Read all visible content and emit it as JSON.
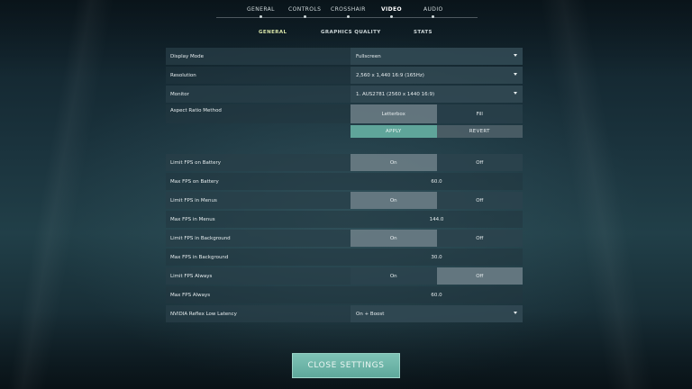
{
  "top_tabs": [
    {
      "label": "GENERAL"
    },
    {
      "label": "CONTROLS"
    },
    {
      "label": "CROSSHAIR"
    },
    {
      "label": "VIDEO"
    },
    {
      "label": "AUDIO"
    }
  ],
  "sub_tabs": [
    {
      "label": "GENERAL"
    },
    {
      "label": "GRAPHICS QUALITY"
    },
    {
      "label": "STATS"
    }
  ],
  "settings": {
    "display_mode": {
      "label": "Display Mode",
      "value": "Fullscreen"
    },
    "resolution": {
      "label": "Resolution",
      "value": "2,560 x 1,440 16:9 (165Hz)"
    },
    "monitor": {
      "label": "Monitor",
      "value": "1. AUS2781 (2560 x 1440 16:9)"
    },
    "aspect": {
      "label": "Aspect Ratio Method",
      "opt1": "Letterbox",
      "opt2": "Fill"
    },
    "apply_label": "APPLY",
    "revert_label": "REVERT",
    "limit_battery": {
      "label": "Limit FPS on Battery",
      "on": "On",
      "off": "Off"
    },
    "max_battery": {
      "label": "Max FPS on Battery",
      "value": "60.0"
    },
    "limit_menus": {
      "label": "Limit FPS in Menus",
      "on": "On",
      "off": "Off"
    },
    "max_menus": {
      "label": "Max FPS in Menus",
      "value": "144.0"
    },
    "limit_background": {
      "label": "Limit FPS in Background",
      "on": "On",
      "off": "Off"
    },
    "max_background": {
      "label": "Max FPS in Background",
      "value": "30.0"
    },
    "limit_always": {
      "label": "Limit FPS Always",
      "on": "On",
      "off": "Off"
    },
    "max_always": {
      "label": "Max FPS Always",
      "value": "60.0"
    },
    "reflex": {
      "label": "NVIDIA Reflex Low Latency",
      "value": "On + Boost"
    }
  },
  "close_label": "CLOSE SETTINGS"
}
